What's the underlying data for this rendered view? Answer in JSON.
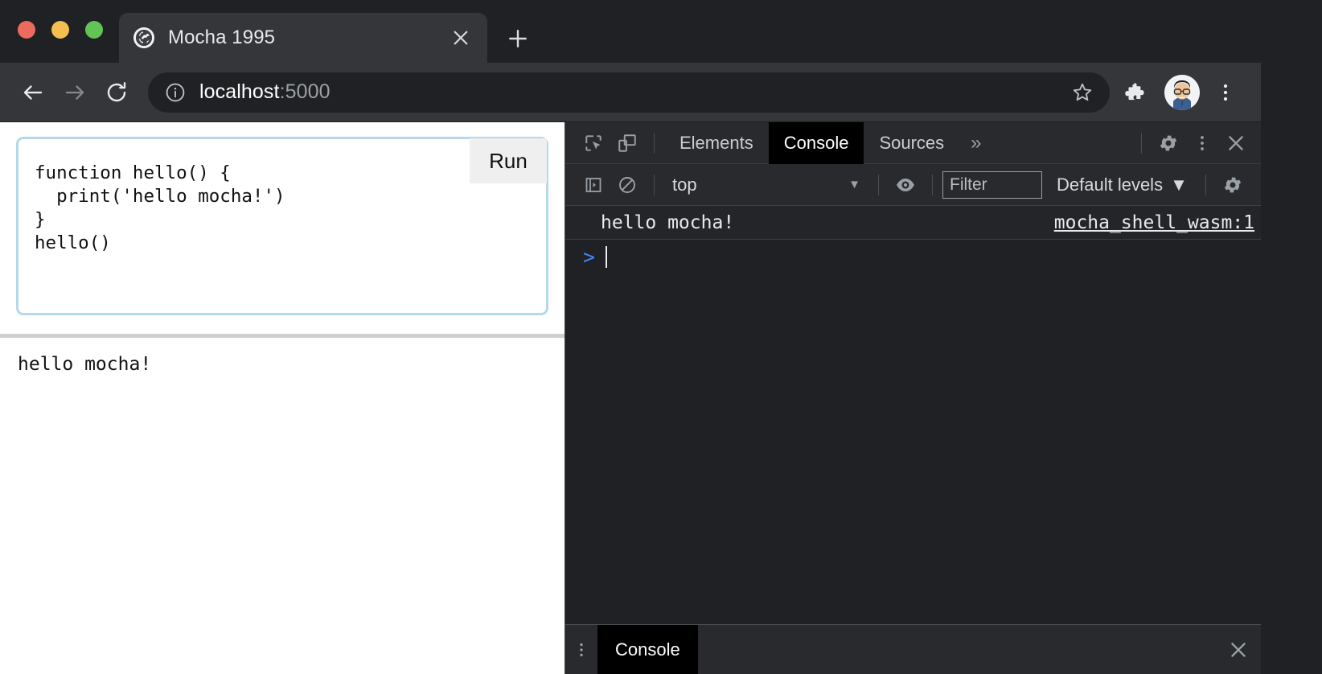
{
  "browser": {
    "window_controls": [
      "close",
      "minimize",
      "maximize"
    ],
    "tab": {
      "title": "Mocha 1995",
      "favicon": "globe-icon",
      "close_label": "×"
    },
    "new_tab_label": "+",
    "toolbar": {
      "back": "←",
      "forward": "→",
      "reload": "⟳",
      "site_info_icon": "info-circle-icon",
      "url_host": "localhost",
      "url_port": ":5000",
      "bookmark_icon": "star-icon",
      "extensions_icon": "puzzle-icon",
      "profile_icon": "avatar-icon",
      "menu_icon": "three-dot-menu-icon"
    }
  },
  "page": {
    "editor": {
      "code": "function hello() {\n  print('hello mocha!')\n}\nhello()",
      "run_label": "Run"
    },
    "output": "hello mocha!"
  },
  "devtools": {
    "tabs": [
      {
        "label": "Elements",
        "active": false
      },
      {
        "label": "Console",
        "active": true
      },
      {
        "label": "Sources",
        "active": false
      }
    ],
    "more_tabs_label": "»",
    "inspect_icon": "inspect-element-icon",
    "device_icon": "device-toolbar-icon",
    "settings_icon": "gear-icon",
    "menu_icon": "three-dot-menu-icon",
    "close_icon": "close-icon",
    "console_toolbar": {
      "sidebar_icon": "console-sidebar-icon",
      "clear_icon": "clear-console-icon",
      "context": "top",
      "context_arrow": "▼",
      "eye_icon": "live-expression-icon",
      "filter_placeholder": "Filter",
      "levels_label": "Default levels",
      "levels_arrow": "▼",
      "settings_icon": "gear-icon"
    },
    "console_messages": [
      {
        "text": "hello mocha!",
        "source": "mocha_shell_wasm:1"
      }
    ],
    "prompt": {
      "caret": ">",
      "value": ""
    },
    "drawer": {
      "menu_icon": "three-dot-menu-icon",
      "tab_label": "Console",
      "close_icon": "close-icon"
    }
  },
  "colors": {
    "chrome_bg": "#202124",
    "toolbar_bg": "#35363A",
    "devtools_bg": "#292A2D",
    "accent_blue": "#4285f4",
    "editor_border": "#b5d9e8"
  }
}
